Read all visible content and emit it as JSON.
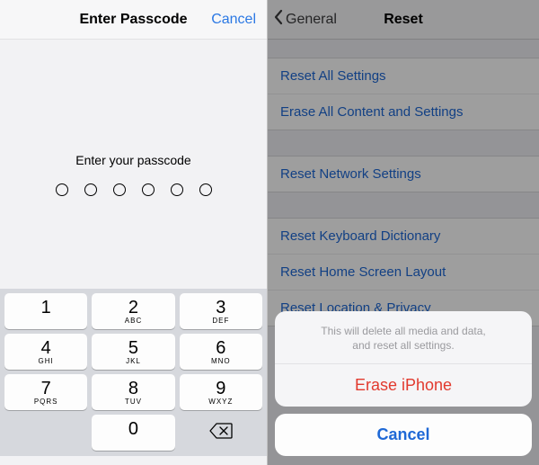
{
  "left": {
    "title": "Enter Passcode",
    "cancel": "Cancel",
    "prompt": "Enter your passcode",
    "passcode_length": 6,
    "keypad": [
      {
        "digit": "1",
        "letters": ""
      },
      {
        "digit": "2",
        "letters": "ABC"
      },
      {
        "digit": "3",
        "letters": "DEF"
      },
      {
        "digit": "4",
        "letters": "GHI"
      },
      {
        "digit": "5",
        "letters": "JKL"
      },
      {
        "digit": "6",
        "letters": "MNO"
      },
      {
        "digit": "7",
        "letters": "PQRS"
      },
      {
        "digit": "8",
        "letters": "TUV"
      },
      {
        "digit": "9",
        "letters": "WXYZ"
      },
      {
        "digit": "0",
        "letters": ""
      }
    ],
    "delete_icon": "backspace-icon"
  },
  "right": {
    "back_label": "General",
    "title": "Reset",
    "groups": [
      [
        "Reset All Settings",
        "Erase All Content and Settings"
      ],
      [
        "Reset Network Settings"
      ],
      [
        "Reset Keyboard Dictionary",
        "Reset Home Screen Layout",
        "Reset Location & Privacy"
      ]
    ],
    "sheet": {
      "message_line1": "This will delete all media and data,",
      "message_line2": "and reset all settings.",
      "destructive": "Erase iPhone",
      "cancel": "Cancel"
    }
  }
}
